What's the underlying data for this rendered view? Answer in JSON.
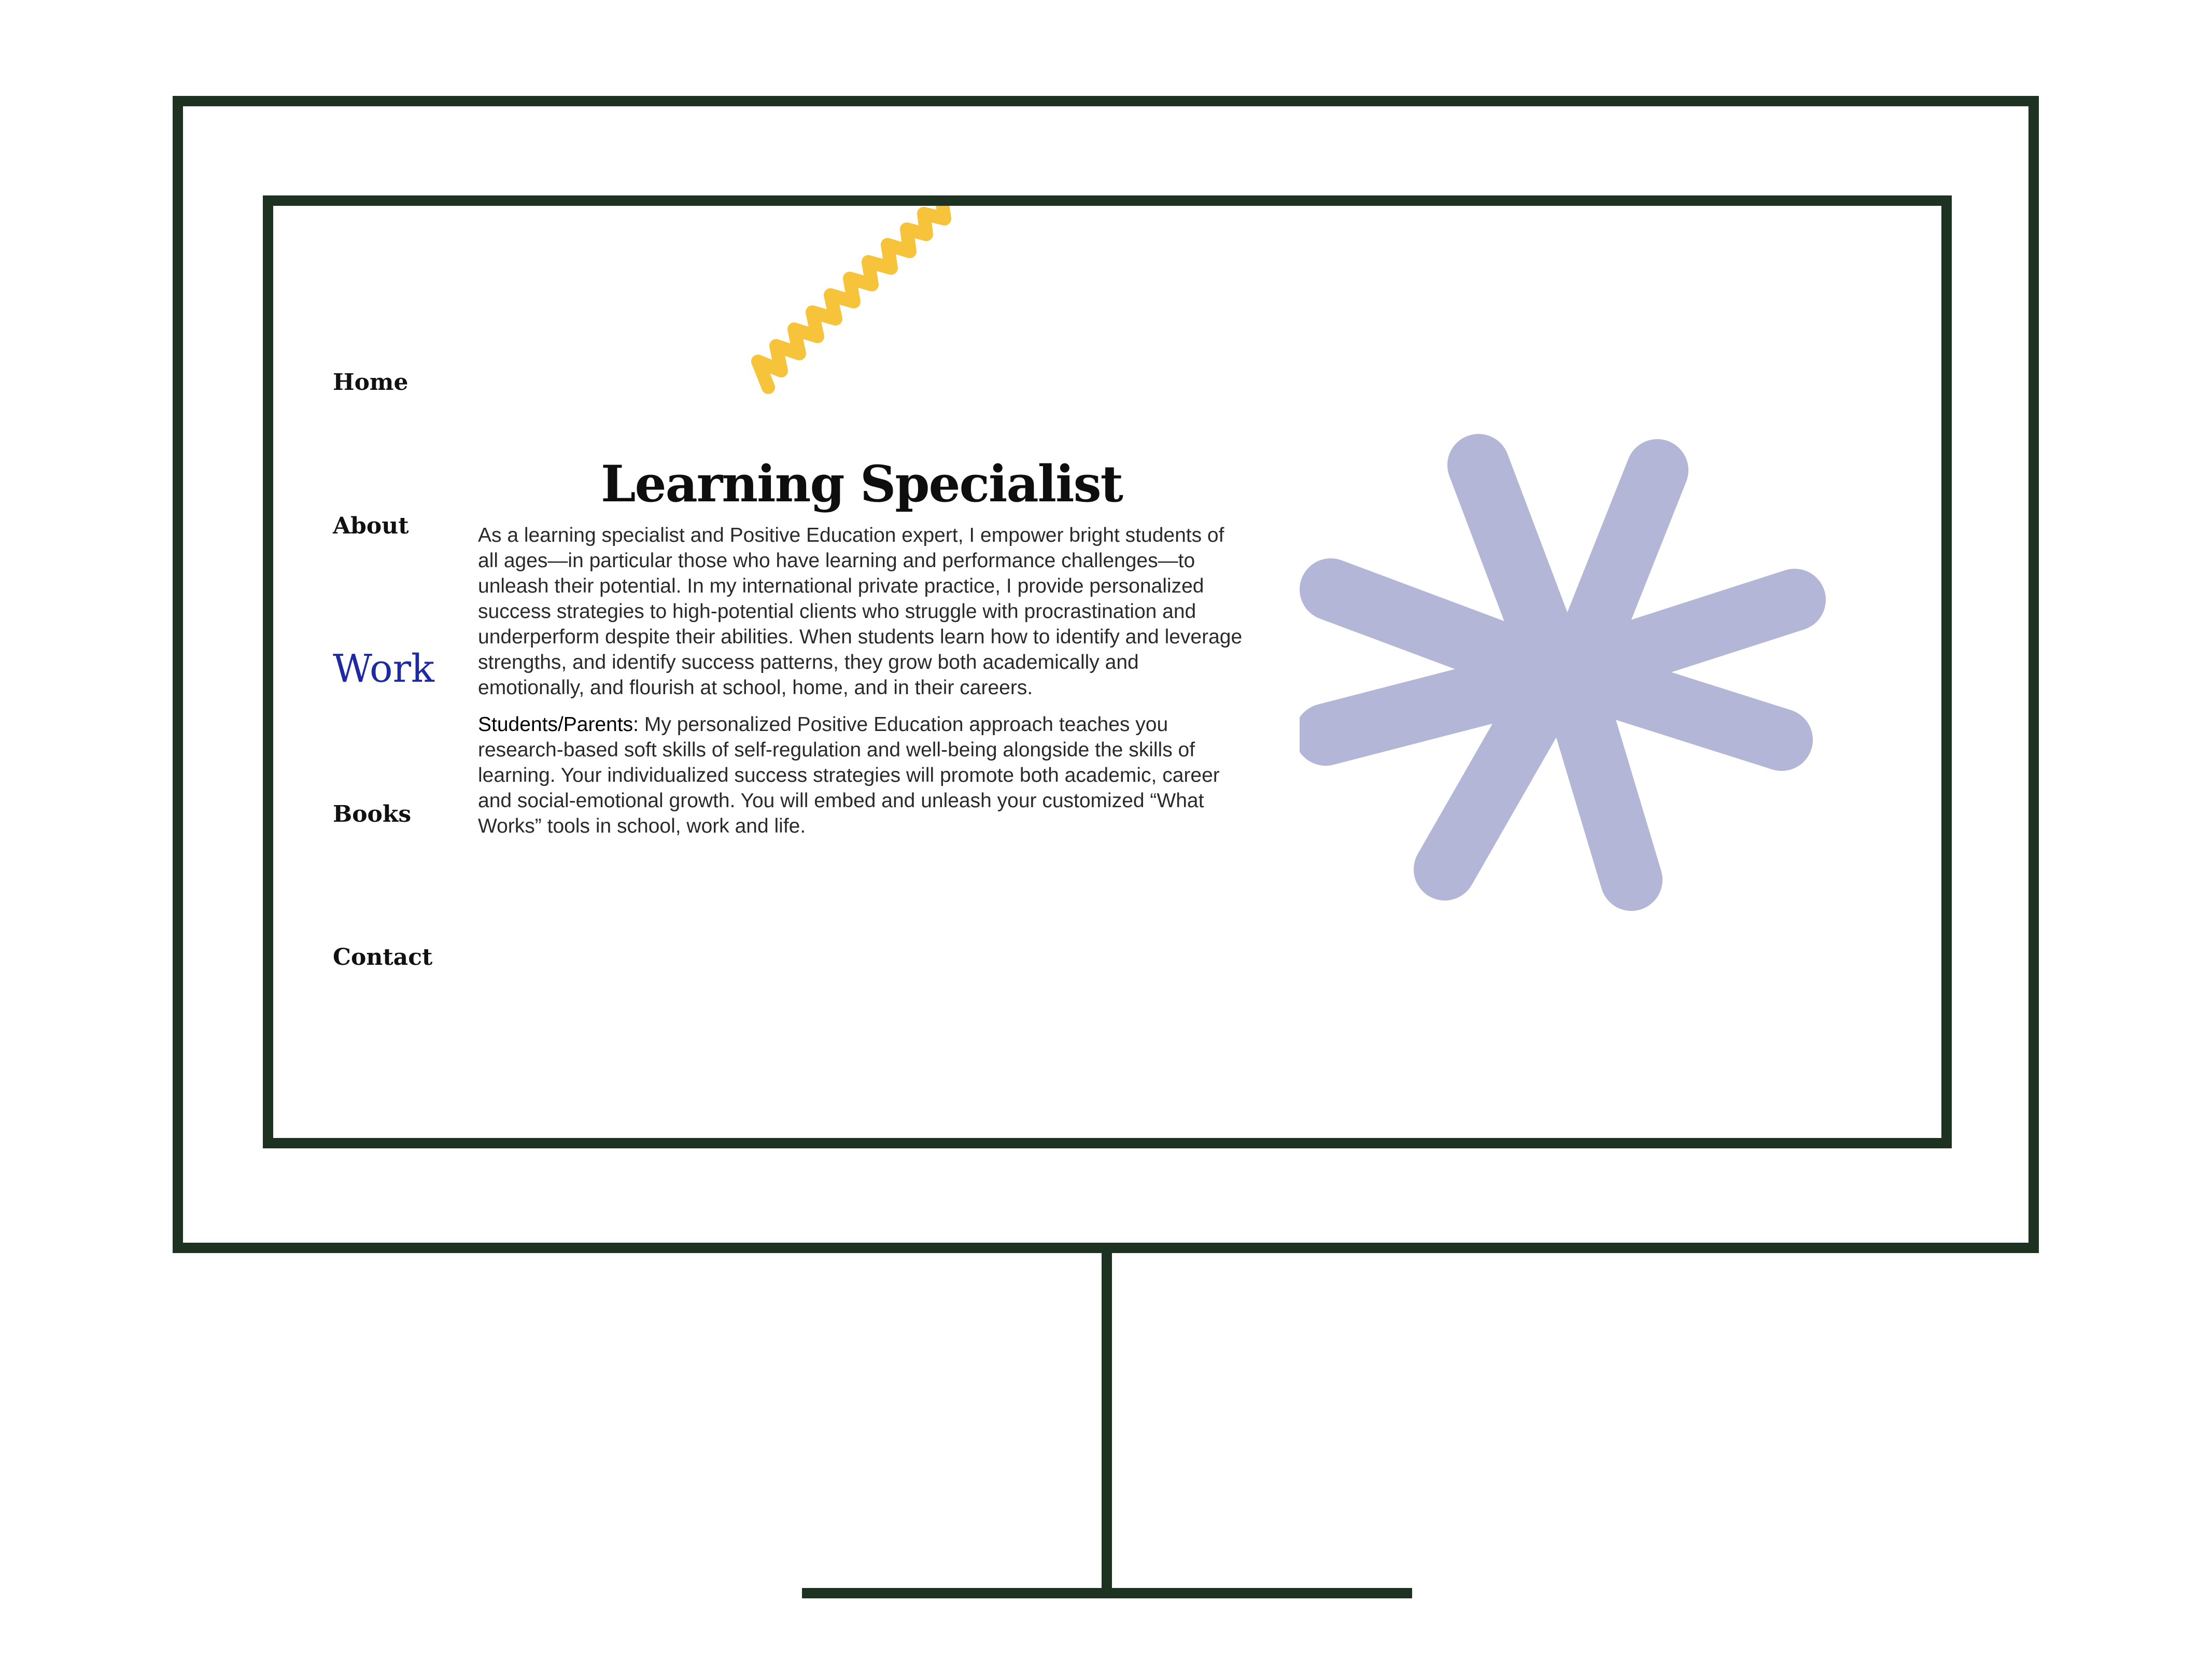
{
  "nav": {
    "items": [
      {
        "label": "Home"
      },
      {
        "label": "About"
      },
      {
        "label": "Work"
      },
      {
        "label": "Books"
      },
      {
        "label": "Contact"
      }
    ],
    "active": "Work"
  },
  "main": {
    "title": "Learning Specialist",
    "paragraph1": "As a learning specialist and Positive Education expert, I empower bright students of all ages—in particular those who have learning and performance challenges—to unleash their potential. In my international private practice, I provide personalized success strategies to high-potential clients who struggle with procrastination and underperform despite their abilities. When students learn how to identify and leverage strengths, and identify success patterns, they grow both academically and emotionally, and flourish at school, home, and in their careers.",
    "paragraph2_lead": "Students/Parents:",
    "paragraph2_body": " My personalized Positive Education approach teaches you research-based soft skills of self-regulation and well-being alongside the skills of learning. Your individualized success strategies will promote both academic, career and social-emotional growth. You will embed and unleash your customized “What Works” tools in school, work and life."
  },
  "decorations": {
    "zigzag_icon": "zigzag-squiggle",
    "asterisk_icon": "asterisk-shape"
  },
  "colors": {
    "frame": "#1d3221",
    "nav_active": "#1d2aa1",
    "zigzag": "#f6c33b",
    "asterisk": "#b3b6d6"
  }
}
